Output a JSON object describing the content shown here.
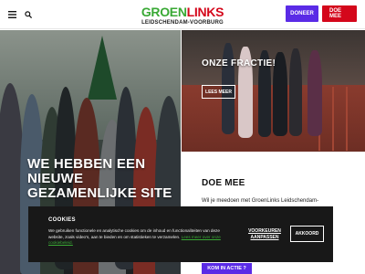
{
  "header": {
    "menu_icon": "hamburger-menu-icon",
    "search_icon": "search-icon",
    "logo": {
      "part_green": "GROEN",
      "part_red": "LINKS",
      "subtitle": "LEIDSCHENDAM-VOORBURG"
    },
    "doneer_label": "DONEER",
    "doemee_label": "DOE MEE"
  },
  "hero": {
    "title": "WE HEBBEN EEN NIEUWE GEZAMENLIJKE SITE"
  },
  "fractie": {
    "title": "ONZE FRACTIE!",
    "button_label": "LEES MEER"
  },
  "doemee": {
    "title": "DOE MEE",
    "text": "Wil je meedoen met GroenLinks Leidschendam-",
    "button_label": "KOM IN ACTIE ?"
  },
  "cookie": {
    "title": "COOKIES",
    "text": "We gebruiken functionele en analytische cookies om de inhoud en functionaliteiten van deze website, zoals video's, aan te bieden en om statistieken te verzamelen.",
    "link_text": "Lees meer over onze cookiebeleid.",
    "preferences_label": "VOORKEUREN AANPASSEN",
    "accept_label": "AKKOORD"
  },
  "colors": {
    "green": "#39a935",
    "red": "#d4071b",
    "purple": "#5a2be6",
    "banner": "#181818"
  }
}
